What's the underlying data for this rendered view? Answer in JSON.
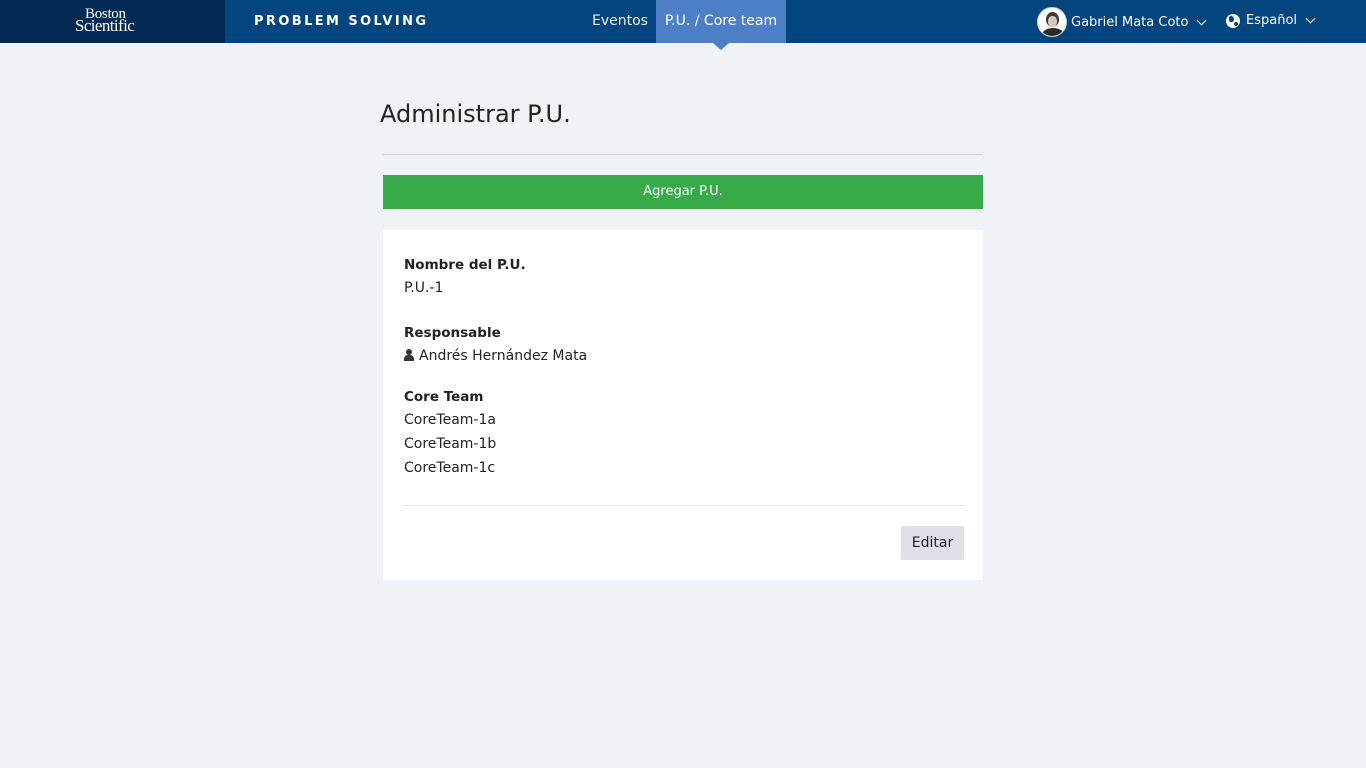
{
  "header": {
    "logo_line1": "Boston",
    "logo_line2": "Scientific",
    "app_title": "PROBLEM SOLVING",
    "nav": [
      {
        "label": "Eventos"
      },
      {
        "label": "P.U. / Core team"
      }
    ],
    "user_name": "Gabriel Mata Coto",
    "language": "Español"
  },
  "main": {
    "title": "Administrar P.U.",
    "add_button": "Agregar P.U.",
    "card": {
      "name_label": "Nombre del P.U.",
      "name_value": "P.U.-1",
      "owner_label": "Responsable",
      "owner_value": "Andrés Hernández Mata",
      "core_team_label": "Core Team",
      "core_teams": [
        "CoreTeam-1a",
        "CoreTeam-1b",
        "CoreTeam-1c"
      ],
      "edit_button": "Editar"
    }
  },
  "colors": {
    "header_bg": "#03457e",
    "logo_bg": "#032a55",
    "nav_active": "#4d7fc6",
    "add_button": "#37ab49",
    "page_bg": "#eff2f7"
  },
  "icons": {
    "avatar": "user-photo",
    "owner": "user-icon",
    "language": "globe-icon",
    "dropdown": "chevron-down-icon"
  }
}
